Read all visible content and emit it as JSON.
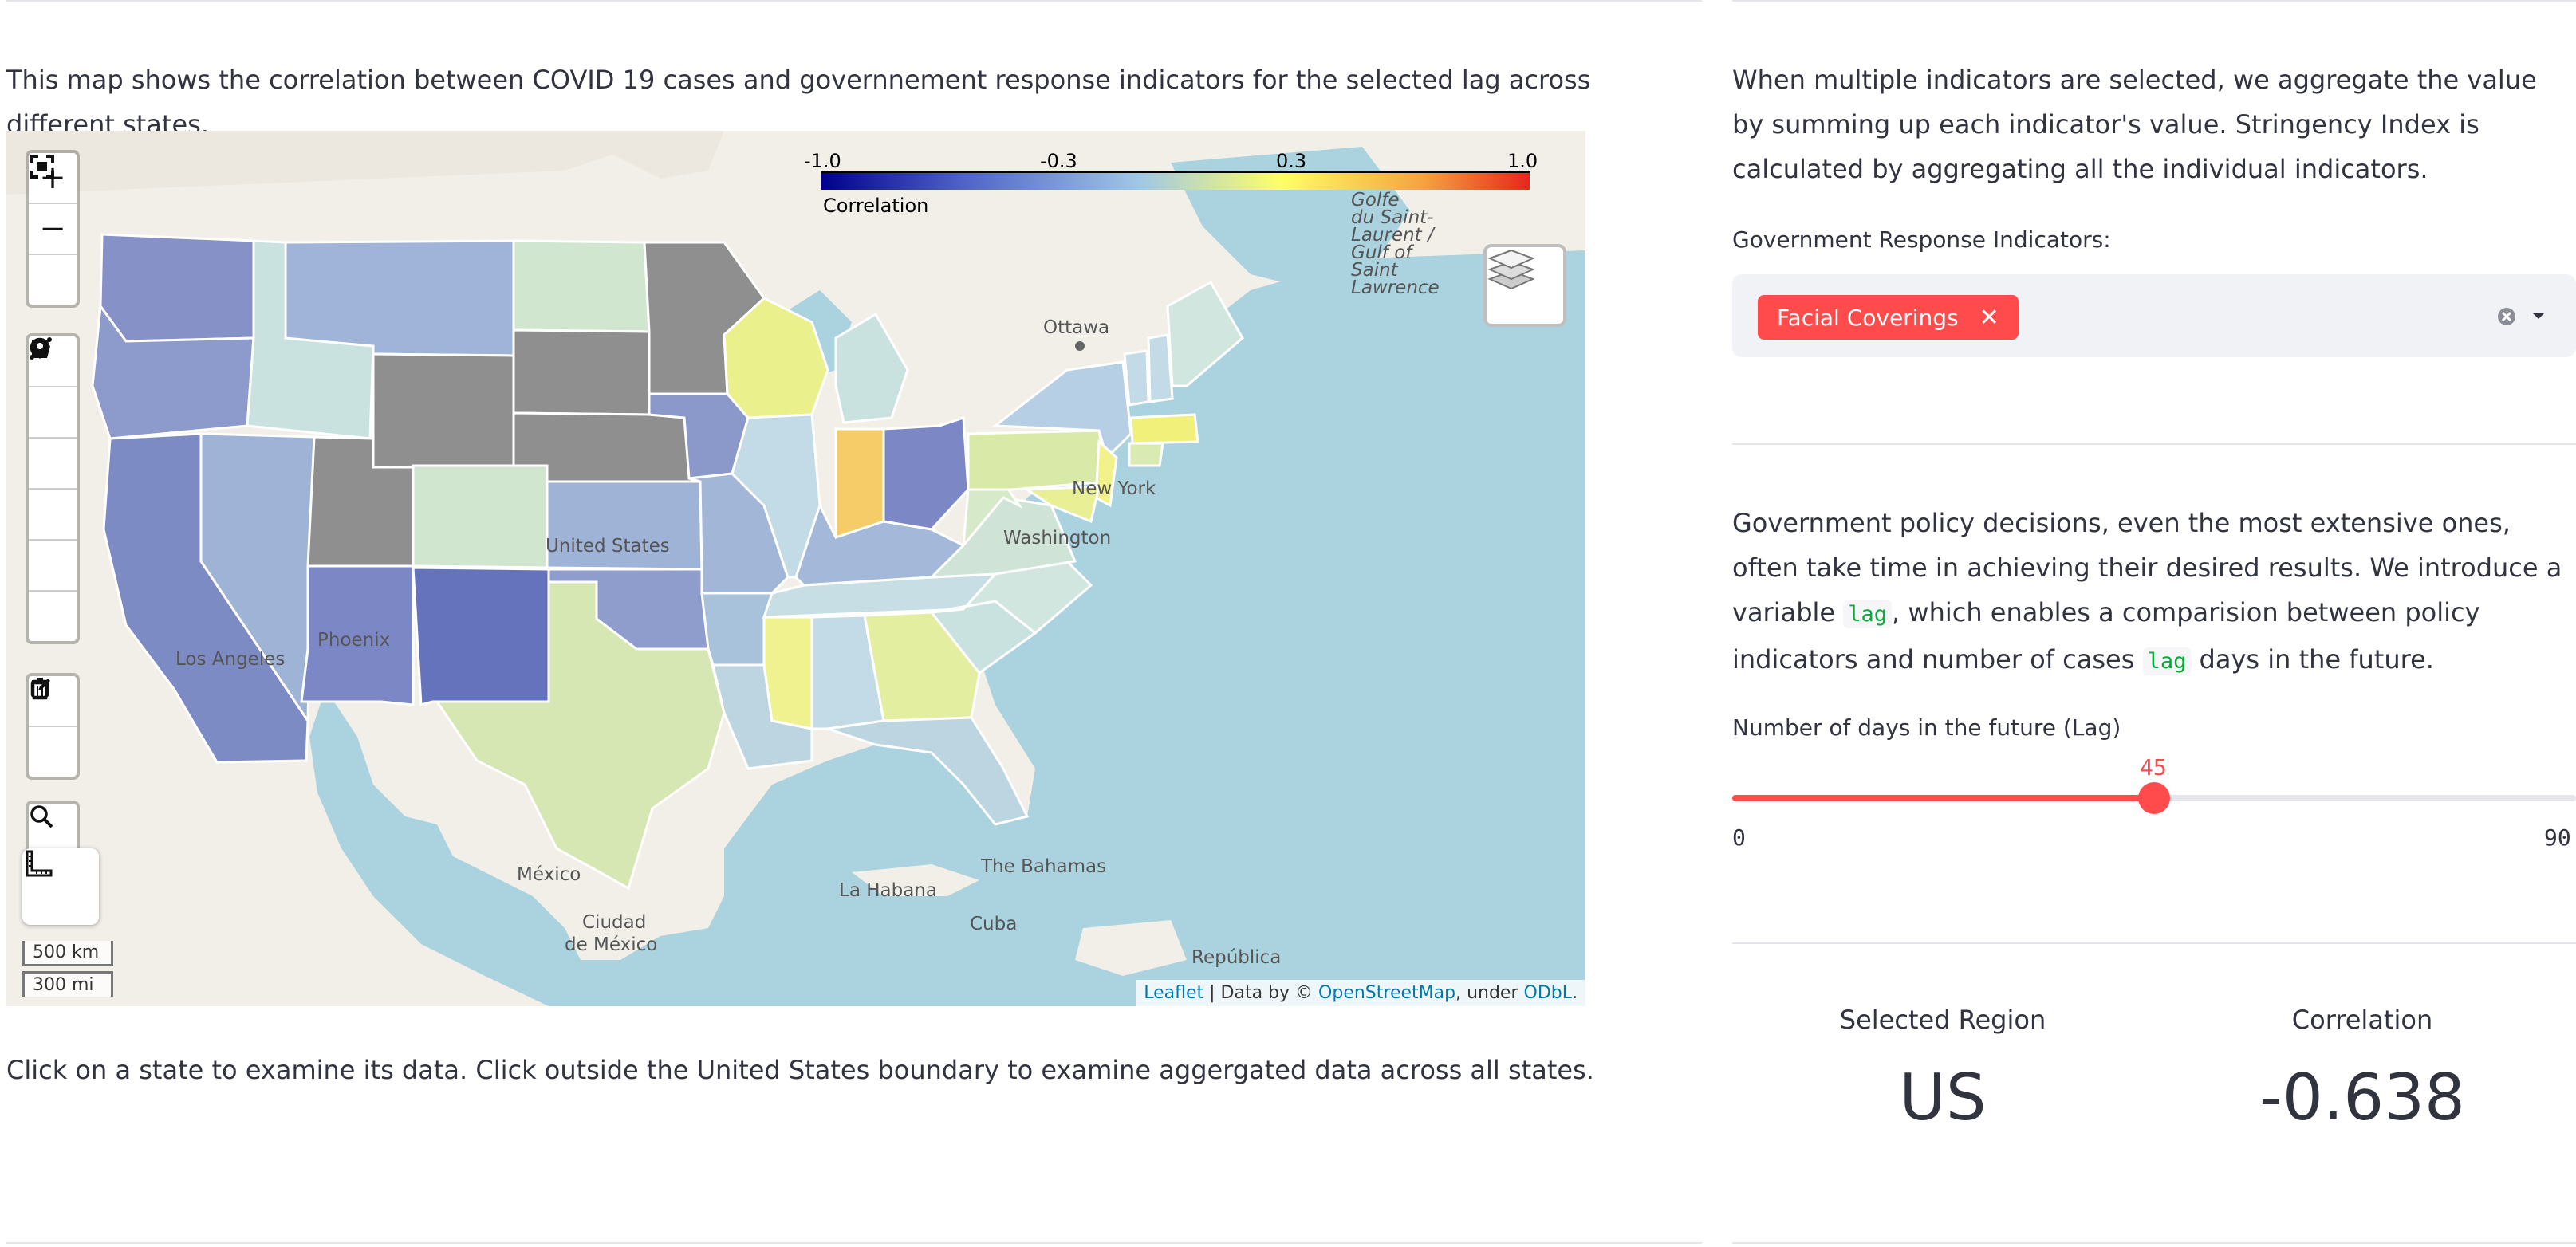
{
  "left": {
    "intro": "This map shows the correlation between COVID 19 cases and governnement response indicators for the selected lag across different states.",
    "footer": "Click on a state to examine its data. Click outside the United States boundary to examine aggergated data across all states."
  },
  "map": {
    "legend": {
      "title": "Correlation",
      "ticks": [
        "-1.0",
        "-0.3",
        "0.3",
        "1.0"
      ],
      "colors": [
        "#00008b",
        "#4f63c8",
        "#a0c8e6",
        "#ffff66",
        "#f4a340",
        "#e8261c"
      ]
    },
    "no_data_color": "#8f8f8f",
    "places": {
      "ottawa": "Ottawa",
      "new_york": "New York",
      "washington": "Washington",
      "united_states": "United States",
      "los_angeles": "Los Angeles",
      "phoenix": "Phoenix",
      "mexico": "México",
      "ciudad": "Ciudad",
      "de_mexico": "de México",
      "la_habana": "La Habana",
      "bahamas": "The Bahamas",
      "cuba": "Cuba",
      "republica": "República",
      "gulf": "Golfe",
      "gulf2": "du Saint-",
      "gulf3": "Laurent /",
      "gulf4": "Gulf of",
      "gulf5": "Saint",
      "gulf6": "Lawrence"
    },
    "controls": {
      "zoom_in": "+",
      "zoom_out": "−"
    },
    "scale": {
      "km": "500 km",
      "mi": "300 mi"
    },
    "attribution": {
      "leaflet": "Leaflet",
      "data_by": " | Data by © ",
      "osm": "OpenStreetMap",
      "under": ", under ",
      "odbl": "ODbL",
      "end": "."
    }
  },
  "right": {
    "agg_text": "When multiple indicators are selected, we aggregate the value by summing up each indicator's value. Stringency Index is calculated by aggregating all the individual indicators.",
    "indicators_label": "Government Response Indicators:",
    "selected_indicator": "Facial Coverings",
    "policy_text_1": "Government policy decisions, even the most extensive ones, often take time in achieving their desired results. We introduce a variable",
    "lag_code": "lag",
    "policy_text_2": ", which enables a comparision between policy indicators and number of cases",
    "policy_text_3": "days in the future.",
    "lag_label": "Number of days in the future (Lag)",
    "slider": {
      "min": 0,
      "max": 90,
      "value": 45,
      "min_label": "0",
      "max_label": "90",
      "value_label": "45"
    },
    "metrics": {
      "region_label": "Selected Region",
      "region_value": "US",
      "corr_label": "Correlation",
      "corr_value": "-0.638"
    }
  }
}
